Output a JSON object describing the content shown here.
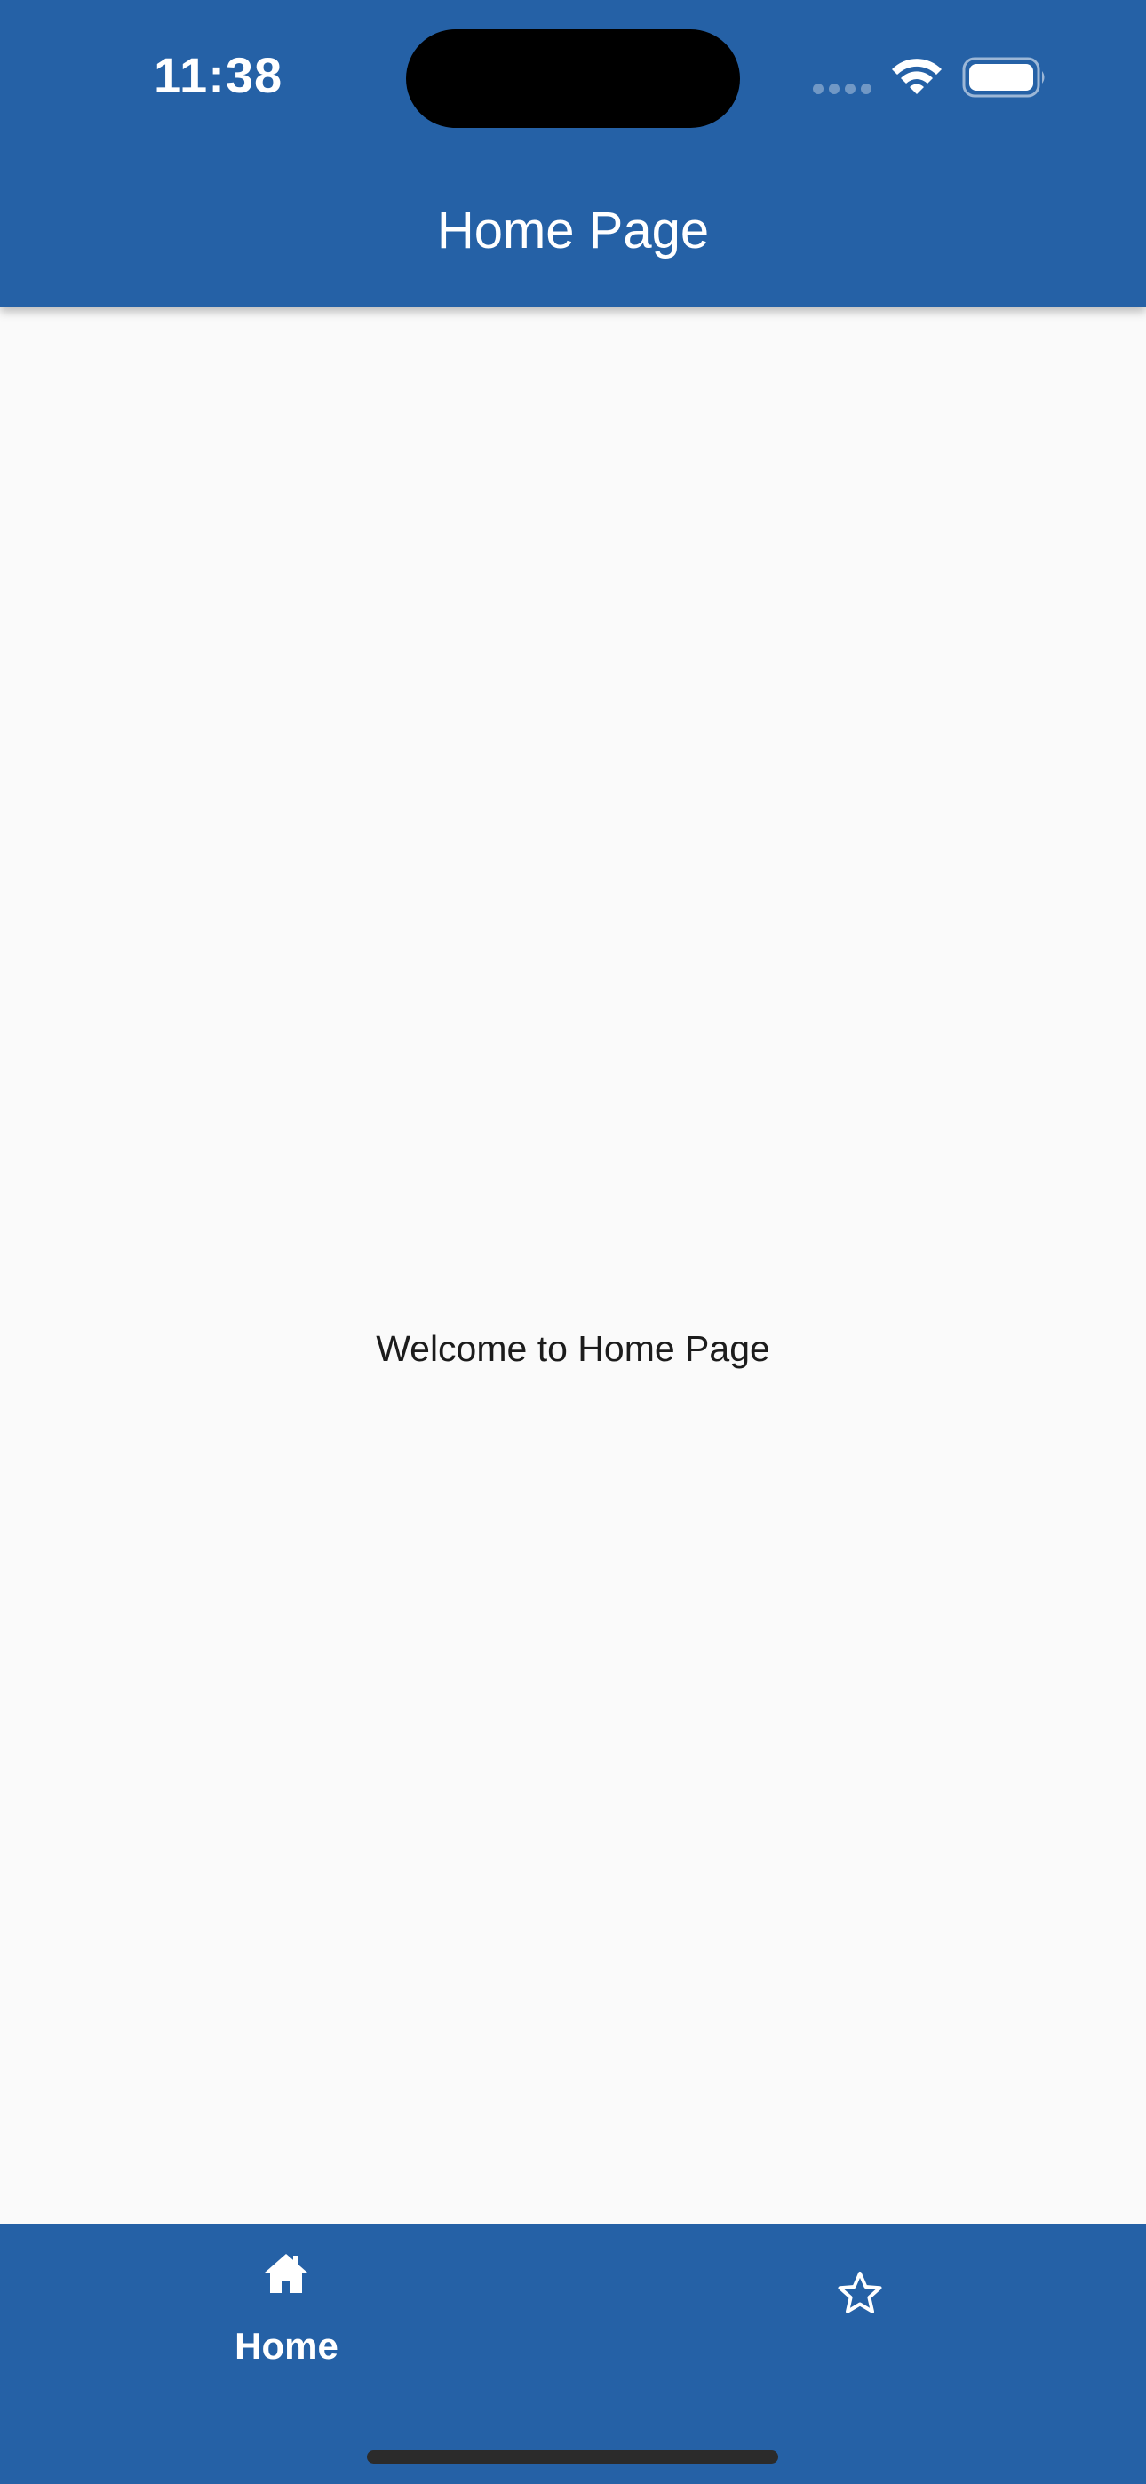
{
  "status_bar": {
    "time": "11:38"
  },
  "header": {
    "title": "Home Page"
  },
  "main": {
    "welcome_text": "Welcome to Home Page"
  },
  "bottom_nav": {
    "items": [
      {
        "label": "Home",
        "icon": "home-icon",
        "selected": true
      },
      {
        "label": "",
        "icon": "star-outline-icon",
        "selected": false
      }
    ]
  },
  "colors": {
    "primary": "#2561a6",
    "background": "#fafafa",
    "text": "#1c1c1c",
    "on_primary": "#ffffff"
  }
}
